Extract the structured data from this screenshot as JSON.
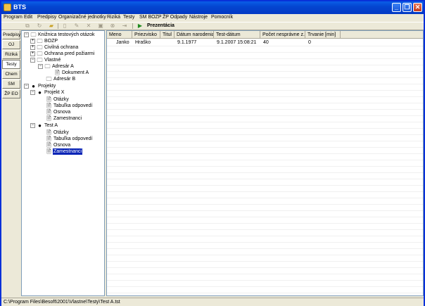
{
  "window": {
    "title": "BTS"
  },
  "menu": [
    "Program",
    "Edit",
    "Predpisy",
    "Organizačné jednotky",
    "Riziká",
    "Testy",
    "SM BOZP",
    "ŽP Odpady",
    "Nástroje",
    "Pomocník"
  ],
  "toolbar": {
    "presentation_label": "Prezentácia"
  },
  "side_tabs": [
    "Predpisy",
    "OJ",
    "Riziká",
    "Testy",
    "Chem",
    "SM",
    "ŽP EO"
  ],
  "active_side_tab": "Testy",
  "tree": {
    "root": "Knižnica testových otázok",
    "bozp": "BOZP",
    "civil": "Civilná ochrana",
    "fire": "Ochrana pred požiarmi",
    "own": "Vlastné",
    "dirA": "Adresár A",
    "docA": "Dokument A",
    "dirB": "Adresár B",
    "projects": "Projekty",
    "projX": "Projekt X",
    "x_q": "Otázky",
    "x_ans": "Tabuľka odpovedí",
    "x_out": "Osnova",
    "x_emp": "Zamestnanci",
    "testA": "Test A",
    "a_q": "Otázky",
    "a_ans": "Tabuľka odpovedí",
    "a_out": "Osnova",
    "a_emp": "Zamestnanci"
  },
  "grid": {
    "columns": [
      "Meno",
      "Priezvisko",
      "Titul",
      "Dátum narodenia",
      "Test-dátum",
      "Počet nesprávne z...",
      "Trvanie [min]"
    ],
    "rows": [
      [
        "Janko",
        "Hraško",
        "",
        "9.1.1977",
        "9.1.2007 15:08:21",
        "40",
        "0"
      ]
    ]
  },
  "status": {
    "path": "C:\\Program Files\\Besoft\\2001\\Vlastne\\Testy\\Test A.tst"
  }
}
